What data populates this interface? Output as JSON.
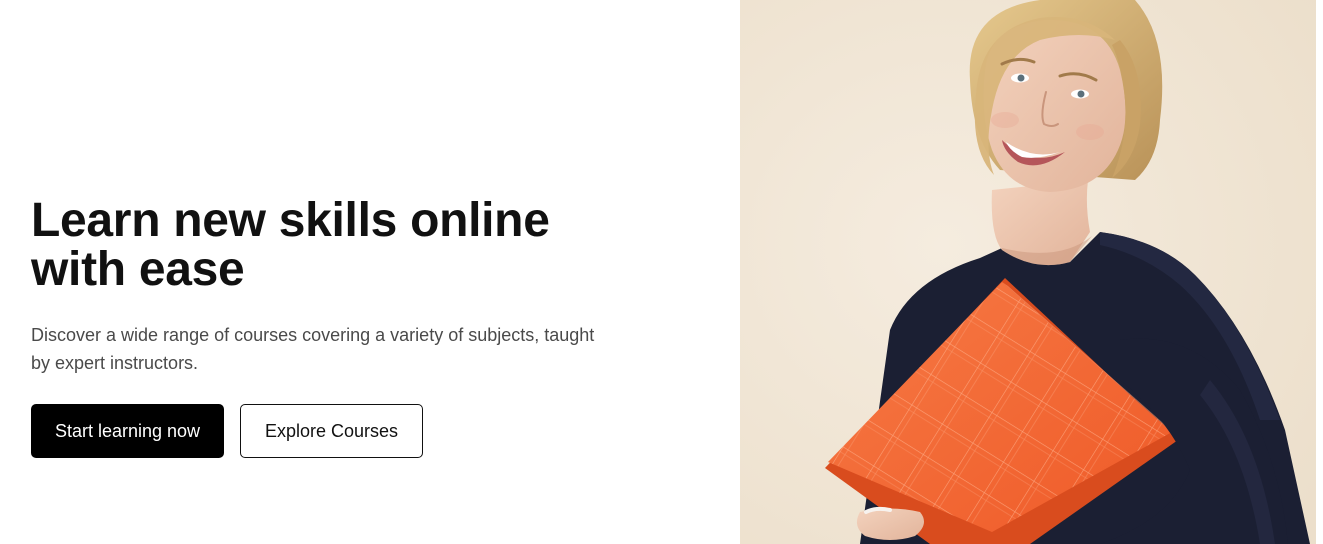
{
  "hero": {
    "title": "Learn new skills online with ease",
    "subtitle": "Discover a wide range of courses covering a variety of subjects, taught by expert instructors.",
    "primary_button": "Start learning now",
    "secondary_button": "Explore Courses"
  },
  "colors": {
    "primary_button_bg": "#000000",
    "image_background": "#f1e6d6",
    "folder_orange": "#f36a35",
    "sweater_navy": "#1b1f33"
  }
}
